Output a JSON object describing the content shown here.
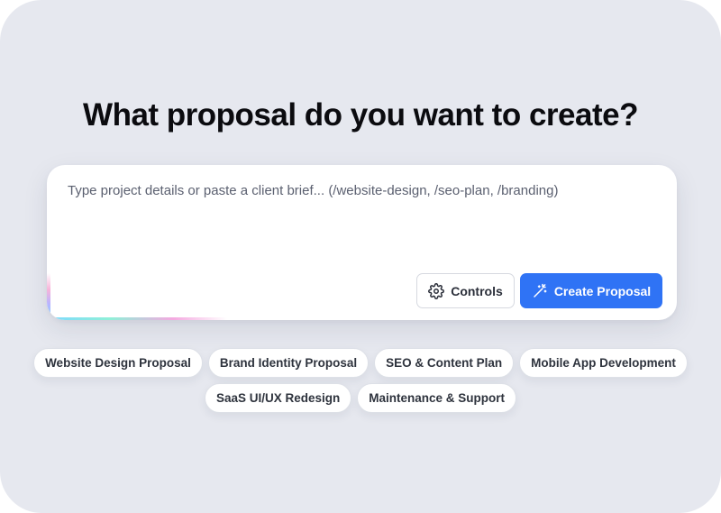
{
  "heading": "What proposal do you want to create?",
  "composer": {
    "placeholder": "Type project details or paste a client brief... (/website-design, /seo-plan, /branding)",
    "value": ""
  },
  "buttons": {
    "controls": {
      "label": "Controls",
      "icon": "gear-icon"
    },
    "create": {
      "label": "Create Proposal",
      "icon": "magic-wand-icon",
      "color": "#2f73f5"
    }
  },
  "suggestions": [
    [
      "Website Design Proposal",
      "Brand Identity Proposal",
      "SEO & Content Plan",
      "Mobile App Development"
    ],
    [
      "SaaS UI/UX Redesign",
      "Maintenance & Support"
    ]
  ],
  "colors": {
    "background": "#e6e8ef",
    "accent": "#2f73f5"
  }
}
